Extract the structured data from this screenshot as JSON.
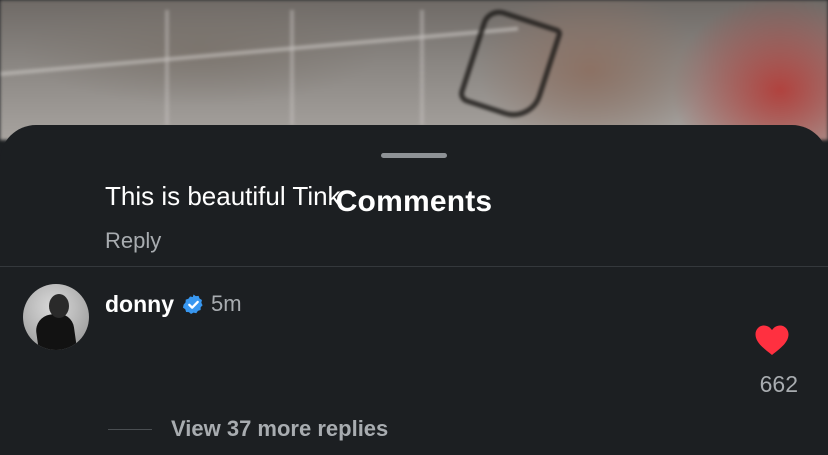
{
  "sheet": {
    "title": "Comments"
  },
  "comment": {
    "username": "donny",
    "verified_icon": "verified-badge-icon",
    "timestamp": "5m",
    "text": "This is beautiful Tink",
    "reply_label": "Reply",
    "like_icon": "heart-icon",
    "like_count": "662",
    "liked": true,
    "view_replies_label": "View 37 more replies"
  },
  "colors": {
    "sheet_background": "#1c1f22",
    "primary_text": "#ffffff",
    "secondary_text": "#a8acb0",
    "verified_blue": "#3897f0",
    "like_red": "#ff3040"
  }
}
